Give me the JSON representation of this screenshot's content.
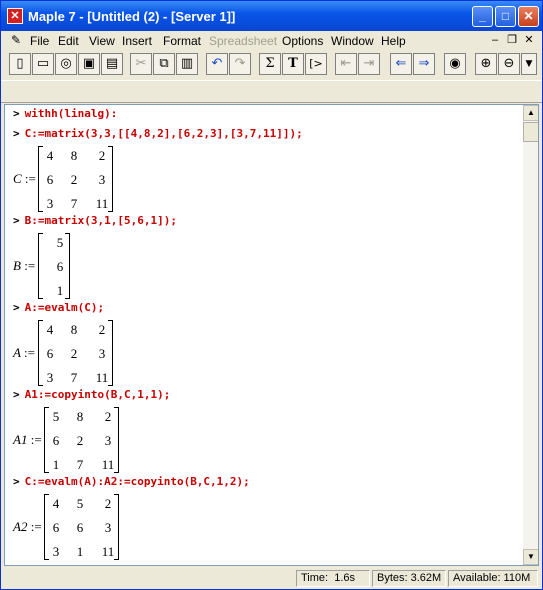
{
  "window": {
    "title": "Maple 7  - [Untitled (2) - [Server 1]]"
  },
  "menubar": {
    "items": [
      {
        "label": "File",
        "disabled": false
      },
      {
        "label": "Edit",
        "disabled": false
      },
      {
        "label": "View",
        "disabled": false
      },
      {
        "label": "Insert",
        "disabled": false
      },
      {
        "label": "Format",
        "disabled": false
      },
      {
        "label": "Spreadsheet",
        "disabled": true
      },
      {
        "label": "Options",
        "disabled": false
      },
      {
        "label": "Window",
        "disabled": false
      },
      {
        "label": "Help",
        "disabled": false
      }
    ]
  },
  "toolbar": {
    "sigma": "Σ",
    "text": "T",
    "prompt": "[>"
  },
  "worksheet": {
    "prompt": ">",
    "inputs": [
      "withh(linalg):",
      "C:=matrix(3,3,[[4,8,2],[6,2,3],[3,7,11]]);",
      "B:=matrix(3,1,[5,6,1]);",
      "A:=evalm(C);",
      "A1:=copyinto(B,C,1,1);",
      "C:=evalm(A):A2:=copyinto(B,C,1,2);"
    ],
    "outputs": [
      {
        "name": "C",
        "assign": ":=",
        "rows": [
          [
            "4",
            "8",
            "2"
          ],
          [
            "6",
            "2",
            "3"
          ],
          [
            "3",
            "7",
            "11"
          ]
        ]
      },
      {
        "name": "B",
        "assign": ":=",
        "rows": [
          [
            "5"
          ],
          [
            "6"
          ],
          [
            "1"
          ]
        ]
      },
      {
        "name": "A",
        "assign": ":=",
        "rows": [
          [
            "4",
            "8",
            "2"
          ],
          [
            "6",
            "2",
            "3"
          ],
          [
            "3",
            "7",
            "11"
          ]
        ]
      },
      {
        "name": "A1",
        "assign": ":=",
        "rows": [
          [
            "5",
            "8",
            "2"
          ],
          [
            "6",
            "2",
            "3"
          ],
          [
            "1",
            "7",
            "11"
          ]
        ]
      },
      {
        "name": "A2",
        "assign": ":=",
        "rows": [
          [
            "4",
            "5",
            "2"
          ],
          [
            "6",
            "6",
            "3"
          ],
          [
            "3",
            "1",
            "11"
          ]
        ]
      }
    ]
  },
  "status": {
    "time_label": "Time:",
    "time_value": "1.6s",
    "bytes": "Bytes: 3.62M",
    "available": "Available: 110M"
  },
  "colors": {
    "input": "#c80000",
    "titlebar": "#0a56e8"
  }
}
